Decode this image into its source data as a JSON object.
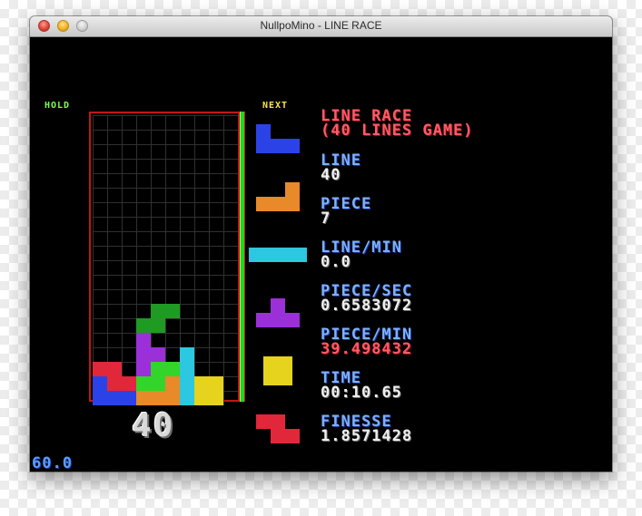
{
  "window": {
    "title": "NullpoMino - LINE RACE"
  },
  "labels": {
    "hold": "HOLD",
    "next": "NEXT"
  },
  "mode_title": {
    "line1": "LINE RACE",
    "line2": "(40 LINES GAME)"
  },
  "stats": [
    {
      "label": "LINE",
      "value": "40"
    },
    {
      "label": "PIECE",
      "value": "7"
    },
    {
      "label": "LINE/MIN",
      "value": "0.0"
    },
    {
      "label": "PIECE/SEC",
      "value": "0.6583072"
    },
    {
      "label": "PIECE/MIN",
      "value": "39.498432"
    },
    {
      "label": "TIME",
      "value": "00:10.65"
    },
    {
      "label": "FINESSE",
      "value": "1.8571428"
    }
  ],
  "lines_remaining": "40",
  "fps": "60.0",
  "colors": {
    "stat_label": "#7fb0ff",
    "piece_min_value": "#ff5b66",
    "red": "#e0283a",
    "blue": "#2b43e6",
    "orange": "#e8892a",
    "cyan": "#2cc7e0",
    "purple": "#9b30d8",
    "yellow": "#e5d31d",
    "green": "#33d52a",
    "dark_green": "#1f9a22"
  },
  "next_queue": [
    "J",
    "L",
    "I",
    "T",
    "O",
    "Z"
  ],
  "board": {
    "columns": 10,
    "rows": 20,
    "cells": [
      {
        "c": 4,
        "r": 13,
        "p": "dark_green"
      },
      {
        "c": 5,
        "r": 13,
        "p": "dark_green"
      },
      {
        "c": 3,
        "r": 14,
        "p": "dark_green"
      },
      {
        "c": 4,
        "r": 14,
        "p": "dark_green"
      },
      {
        "c": 3,
        "r": 15,
        "p": "purple"
      },
      {
        "c": 3,
        "r": 16,
        "p": "purple"
      },
      {
        "c": 4,
        "r": 16,
        "p": "purple"
      },
      {
        "c": 6,
        "r": 16,
        "p": "cyan"
      },
      {
        "c": 0,
        "r": 17,
        "p": "red"
      },
      {
        "c": 1,
        "r": 17,
        "p": "red"
      },
      {
        "c": 3,
        "r": 17,
        "p": "purple"
      },
      {
        "c": 4,
        "r": 17,
        "p": "green"
      },
      {
        "c": 5,
        "r": 17,
        "p": "green"
      },
      {
        "c": 6,
        "r": 17,
        "p": "cyan"
      },
      {
        "c": 0,
        "r": 18,
        "p": "blue"
      },
      {
        "c": 1,
        "r": 18,
        "p": "red"
      },
      {
        "c": 2,
        "r": 18,
        "p": "red"
      },
      {
        "c": 3,
        "r": 18,
        "p": "green"
      },
      {
        "c": 4,
        "r": 18,
        "p": "green"
      },
      {
        "c": 5,
        "r": 18,
        "p": "orange"
      },
      {
        "c": 6,
        "r": 18,
        "p": "cyan"
      },
      {
        "c": 7,
        "r": 18,
        "p": "yellow"
      },
      {
        "c": 8,
        "r": 18,
        "p": "yellow"
      },
      {
        "c": 0,
        "r": 19,
        "p": "blue"
      },
      {
        "c": 1,
        "r": 19,
        "p": "blue"
      },
      {
        "c": 2,
        "r": 19,
        "p": "blue"
      },
      {
        "c": 3,
        "r": 19,
        "p": "orange"
      },
      {
        "c": 4,
        "r": 19,
        "p": "orange"
      },
      {
        "c": 5,
        "r": 19,
        "p": "orange"
      },
      {
        "c": 6,
        "r": 19,
        "p": "cyan"
      },
      {
        "c": 7,
        "r": 19,
        "p": "yellow"
      },
      {
        "c": 8,
        "r": 19,
        "p": "yellow"
      }
    ]
  }
}
